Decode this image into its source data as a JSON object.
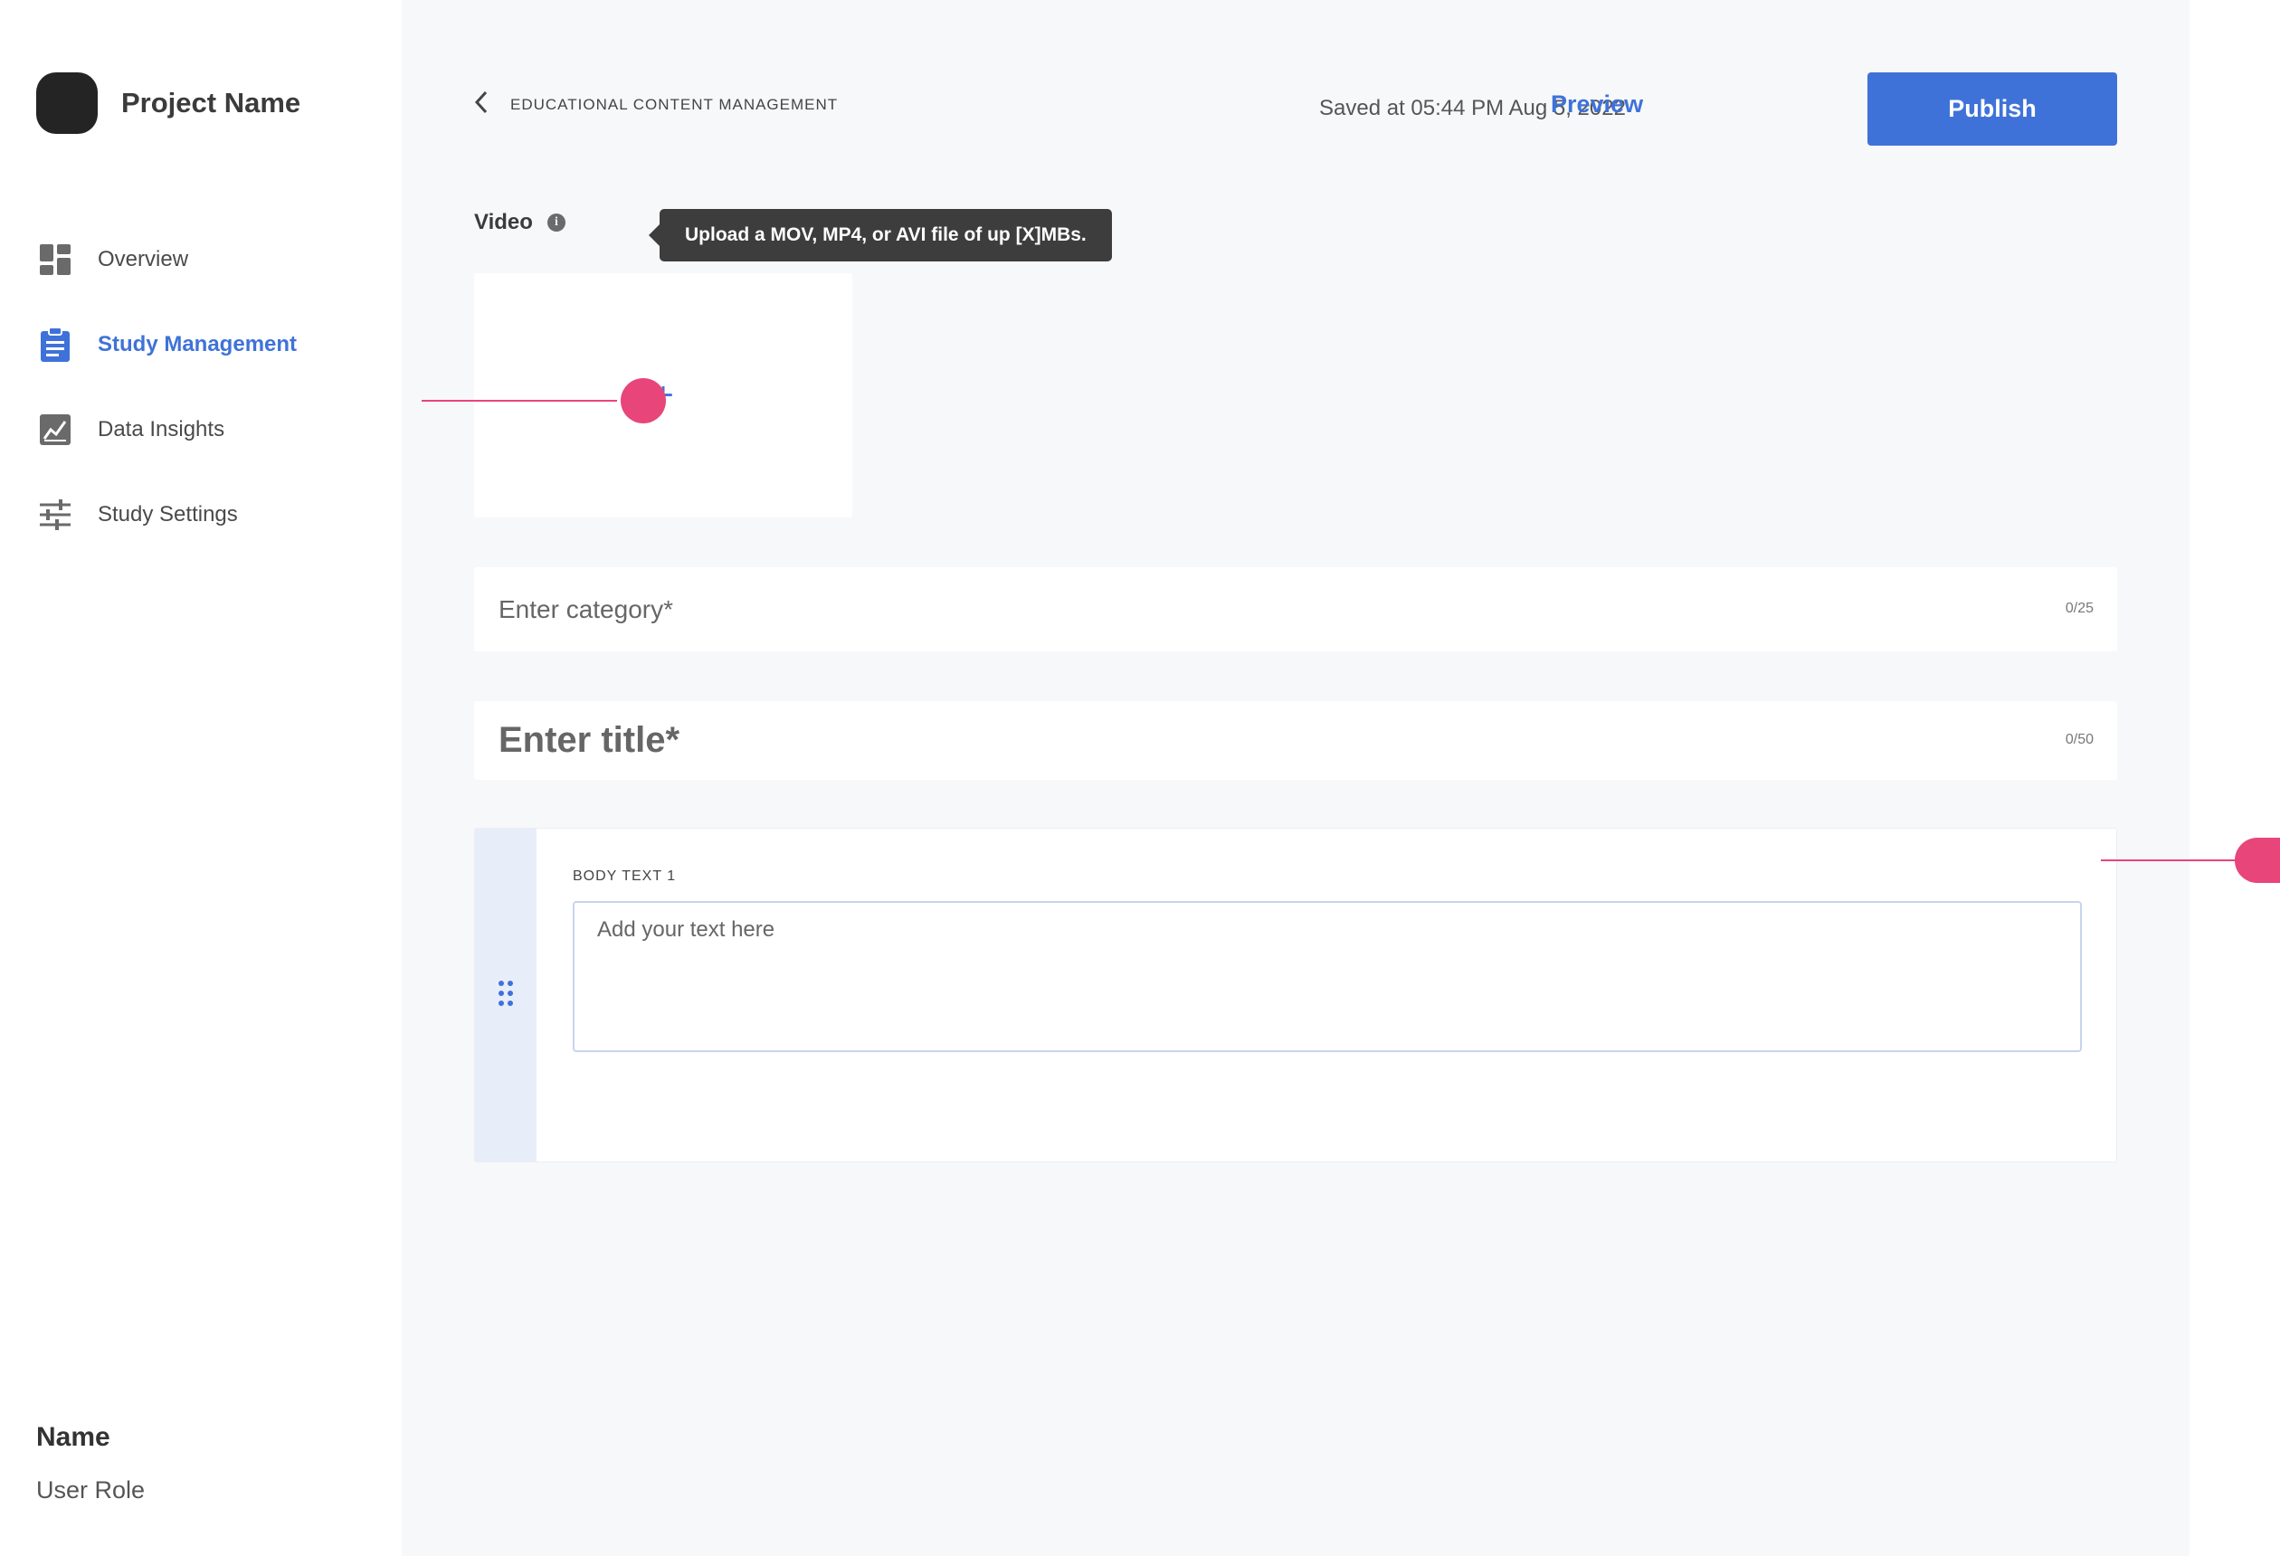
{
  "sidebar": {
    "project_name": "Project Name",
    "items": [
      {
        "label": "Overview",
        "icon": "dashboard-icon",
        "active": false
      },
      {
        "label": "Study Management",
        "icon": "clipboard-icon",
        "active": true
      },
      {
        "label": "Data Insights",
        "icon": "chart-icon",
        "active": false
      },
      {
        "label": "Study Settings",
        "icon": "sliders-icon",
        "active": false
      }
    ],
    "user": {
      "name": "Name",
      "role": "User Role"
    }
  },
  "header": {
    "breadcrumb": "EDUCATIONAL CONTENT MANAGEMENT",
    "saved_status": "Saved at 05:44 PM Aug 5, 2022",
    "preview_label": "Preview",
    "publish_label": "Publish"
  },
  "video": {
    "label": "Video",
    "tooltip": "Upload a MOV, MP4, or AVI file of up [X]MBs.",
    "add_symbol": "+"
  },
  "category": {
    "placeholder": "Enter category*",
    "value": "",
    "counter": "0/25"
  },
  "title": {
    "placeholder": "Enter title*",
    "value": "",
    "counter": "0/50"
  },
  "body": {
    "label": "BODY TEXT 1",
    "placeholder": "Add your text here",
    "value": ""
  },
  "colors": {
    "accent": "#3f72d9",
    "annotation": "#e8457a",
    "tooltip_bg": "#3d3d3d"
  }
}
